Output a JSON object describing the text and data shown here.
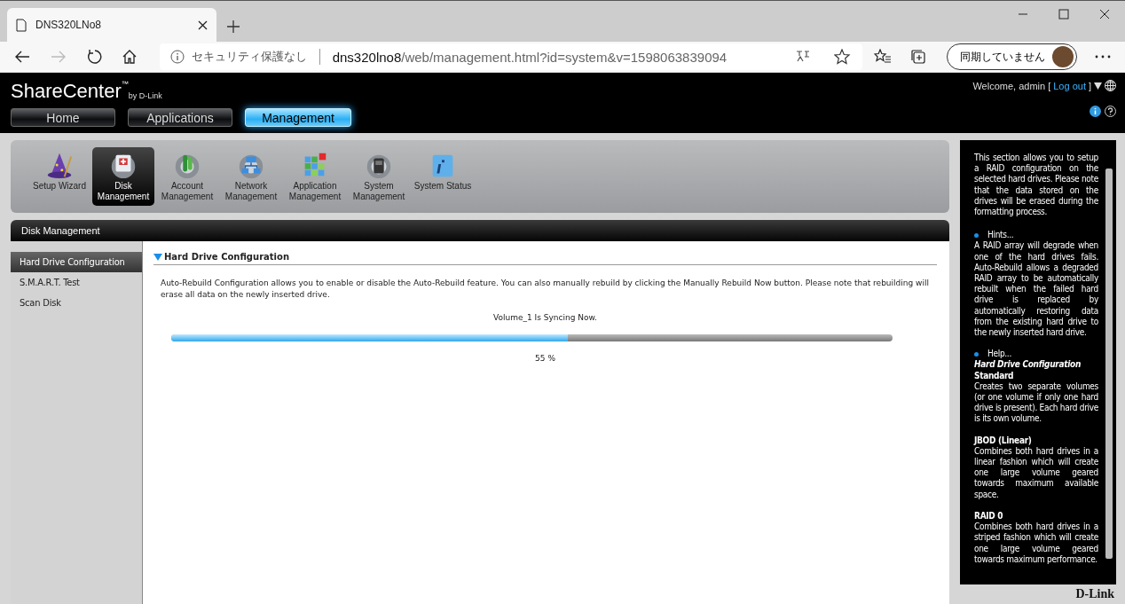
{
  "browser": {
    "tab_title": "DNS320LNo8",
    "security_label": "セキュリティ保護なし",
    "url_host": "dns320lno8",
    "url_path": "/web/management.html?id=system&v=1598063839094",
    "profile_label": "同期していません"
  },
  "header": {
    "logo": "ShareCenter",
    "logo_mark": "™",
    "logo_by": "by D-Link",
    "welcome": "Welcome, admin [",
    "logout": "Log out",
    "welcome_end": "]",
    "nav": [
      {
        "label": "Home",
        "selected": false
      },
      {
        "label": "Applications",
        "selected": false
      },
      {
        "label": "Management",
        "selected": true
      }
    ]
  },
  "toolbar": [
    {
      "label": "Setup Wizard",
      "selected": false
    },
    {
      "label": "Disk Management",
      "selected": true
    },
    {
      "label": "Account Management",
      "selected": false
    },
    {
      "label": "Network Management",
      "selected": false
    },
    {
      "label": "Application Management",
      "selected": false
    },
    {
      "label": "System Management",
      "selected": false
    },
    {
      "label": "System Status",
      "selected": false
    }
  ],
  "panel": {
    "title": "Disk Management",
    "menu": [
      {
        "label": "Hard Drive Configuration",
        "selected": true
      },
      {
        "label": "S.M.A.R.T. Test",
        "selected": false
      },
      {
        "label": "Scan Disk",
        "selected": false
      }
    ],
    "section_title": "Hard Drive Configuration",
    "description": "Auto-Rebuild Configuration allows you to enable or disable the Auto-Rebuild feature. You can also manually rebuild by clicking the Manually Rebuild Now button. Please note that rebuilding will erase all data on the newly inserted drive.",
    "status": "Volume_1 Is Syncing Now.",
    "level": 0.55,
    "percent": "55 %"
  },
  "help": [
    {
      "kind": "paragraph",
      "text": "This section allows you to setup a RAID configuration on the selected hard drives. Please note that the data stored on the drives will be erased during the formatting process."
    },
    {
      "kind": "bullet",
      "text": "Hints..."
    },
    {
      "kind": "text",
      "text": "A RAID array will degrade when one of the hard drives fails. Auto-Rebuild allows a degraded RAID array to be automatically rebuilt when the failed hard drive is replaced by automatically restoring data from the existing hard drive to the newly inserted hard drive."
    },
    {
      "kind": "bullet",
      "text": "Help..."
    },
    {
      "kind": "heading",
      "text": "Hard Drive Configuration"
    },
    {
      "kind": "subheading",
      "text": "Standard"
    },
    {
      "kind": "text",
      "text": "Creates two separate volumes (or one volume if only one hard drive is present). Each hard drive is its own volume."
    },
    {
      "kind": "subheading",
      "text": "JBOD (Linear)"
    },
    {
      "kind": "text",
      "text": "Combines both hard drives in a linear fashion which will create one large volume geared towards maximum available space."
    },
    {
      "kind": "subheading",
      "text": "RAID 0"
    },
    {
      "kind": "text",
      "text": "Combines both hard drives in a striped fashion which will create one large volume geared towards maximum performance."
    }
  ],
  "footer_logo": "D-Link"
}
